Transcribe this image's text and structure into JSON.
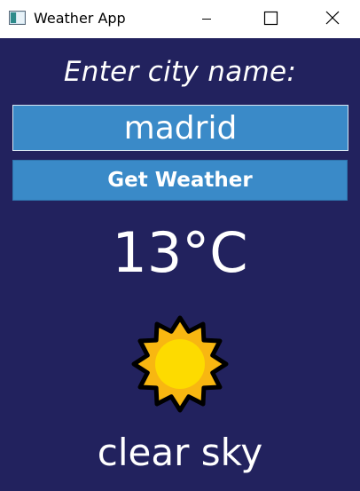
{
  "window": {
    "title": "Weather App",
    "background": "#22225e",
    "accent": "#3a8ac8"
  },
  "controls": {
    "minimize_icon": "minimize-icon",
    "maximize_icon": "maximize-icon",
    "close_icon": "close-icon"
  },
  "form": {
    "prompt": "Enter city name:",
    "city_value": "madrid",
    "button_label": "Get Weather"
  },
  "weather": {
    "temperature": "13°C",
    "condition": "clear sky",
    "icon": "sun-icon"
  }
}
